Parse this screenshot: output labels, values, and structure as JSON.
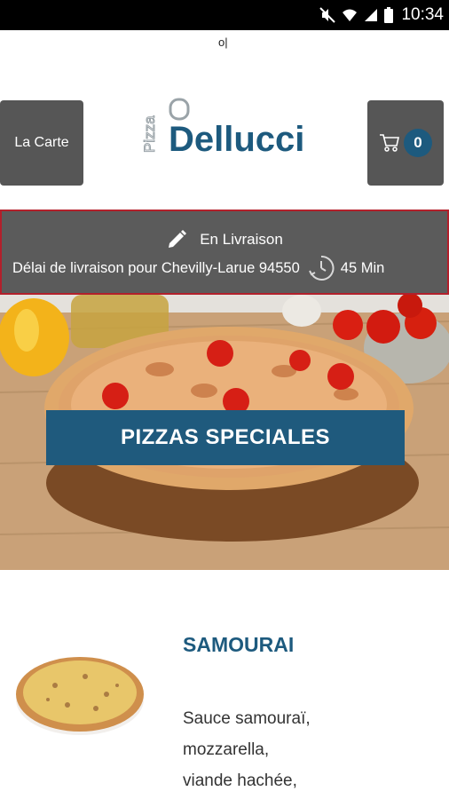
{
  "status_bar": {
    "time": "10:34",
    "icons": [
      "mute-icon",
      "wifi-icon",
      "signal-icon",
      "battery-icon"
    ]
  },
  "cursor_text": "o|",
  "header": {
    "menu_label": "La Carte",
    "logo": {
      "top_word": "Pizza",
      "brand": "Dellucci"
    },
    "cart_count": "0"
  },
  "delivery": {
    "mode_label": "En Livraison",
    "delay_text": "Délai de livraison pour Chevilly-Larue 94550",
    "delay_value": "45 Min"
  },
  "hero": {
    "category_title": "PIZZAS SPECIALES"
  },
  "product": {
    "name": "SAMOURAI",
    "description_lines": [
      "Sauce samouraï,",
      "mozzarella,",
      "viande hachée,"
    ]
  },
  "colors": {
    "brand_blue": "#1d5a7e",
    "header_grey": "#565656",
    "banner_border": "#b2202b"
  }
}
